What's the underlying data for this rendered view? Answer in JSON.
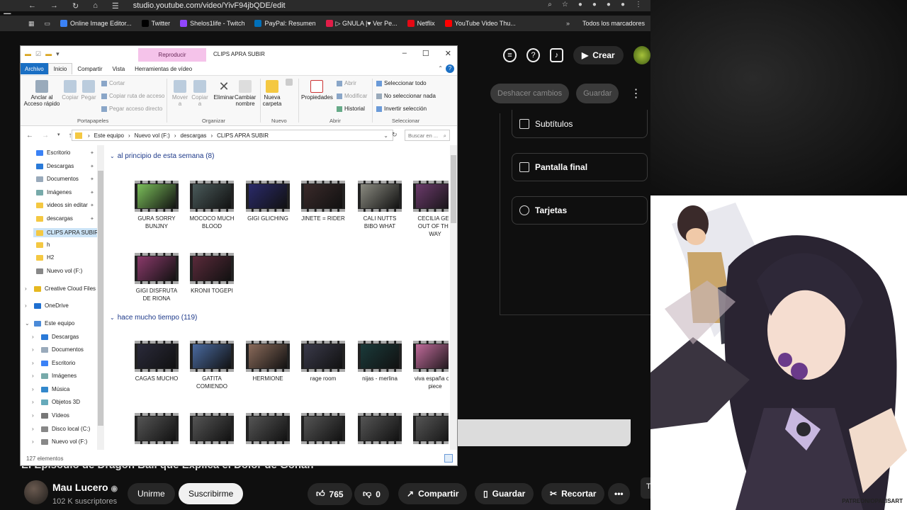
{
  "browser": {
    "url": "studio.youtube.com/video/YivF94jbQDE/edit",
    "bookmarks": [
      {
        "label": "Online Image Editor...",
        "color": "#3b82f6"
      },
      {
        "label": "Twitter",
        "color": "#000000"
      },
      {
        "label": "Shelos1life - Twitch",
        "color": "#9146ff"
      },
      {
        "label": "PayPal: Resumen",
        "color": "#0070ba"
      },
      {
        "label": "▷ GNULA |♥ Ver Pe...",
        "color": "#e11d48"
      },
      {
        "label": "Netflix",
        "color": "#e50914"
      },
      {
        "label": "YouTube Video Thu...",
        "color": "#ff0000"
      }
    ],
    "all_bookmarks": "Todos los marcadores"
  },
  "studio": {
    "create_label": "Crear",
    "discard_label": "Deshacer cambios",
    "save_label": "Guardar",
    "cards": [
      {
        "label": "Subtítulos"
      },
      {
        "label": "Pantalla final"
      },
      {
        "label": "Tarjetas"
      }
    ]
  },
  "youtube": {
    "video_title": "El Episodio de Dragon Ball que Explica el Dolor de Gohan",
    "channel_name": "Mau Lucero",
    "subscribers": "102 K suscriptores",
    "join_label": "Unirme",
    "subscribe_label": "Suscribirme",
    "likes": "765",
    "dislikes": "0",
    "share_label": "Compartir",
    "save_label": "Guardar",
    "clip_label": "Recortar",
    "partial_label": "T"
  },
  "explorer": {
    "context_tab": "Reproducir",
    "window_title": "CLIPS APRA SUBIR",
    "menus": [
      "Archivo",
      "Inicio",
      "Compartir",
      "Vista",
      "Herramientas de vídeo"
    ],
    "ribbon": {
      "pin_label": "Anclar al Acceso rápido",
      "copy_label": "Copiar",
      "paste_label": "Pegar",
      "cut_label": "Cortar",
      "copy_path_label": "Copiar ruta de acceso",
      "paste_shortcut_label": "Pegar acceso directo",
      "clipboard_group": "Portapapeles",
      "move_label": "Mover a",
      "copyto_label": "Copiar a",
      "delete_label": "Eliminar",
      "rename_label": "Cambiar nombre",
      "organize_group": "Organizar",
      "newfolder_label": "Nueva carpeta",
      "new_group": "Nuevo",
      "properties_label": "Propiedades",
      "open_label": "Abrir",
      "modify_label": "Modificar",
      "history_label": "Historial",
      "open_group": "Abrir",
      "select_all": "Seleccionar todo",
      "select_none": "No seleccionar nada",
      "invert_selection": "Invertir selección",
      "select_group": "Seleccionar"
    },
    "breadcrumb": [
      "Este equipo",
      "Nuevo vol (F:)",
      "descargas",
      "CLIPS APRA SUBIR"
    ],
    "search_placeholder": "Buscar en ...",
    "nav_items": [
      "Escritorio",
      "Descargas",
      "Documentos",
      "Imágenes",
      "videos sin editar",
      "descargas",
      "CLIPS APRA SUBIR",
      "h",
      "H2",
      "Nuevo vol (F:)",
      "Creative Cloud Files",
      "OneDrive",
      "Este equipo",
      "Descargas",
      "Documentos",
      "Escritorio",
      "Imágenes",
      "Música",
      "Objetos 3D",
      "Vídeos",
      "Disco local (C:)",
      "Nuevo vol (F:)"
    ],
    "section1": "al principio de esta semana (8)",
    "section2": "hace mucho tiempo (119)",
    "files1": [
      {
        "name": "GURA SORRY BUNJNY",
        "color": "#7bbf5a"
      },
      {
        "name": "MOCOCO MUCH BLOOD",
        "color": "#4a5a5a"
      },
      {
        "name": "GIGI GLICHING",
        "color": "#2a2a6a"
      },
      {
        "name": "JINETE = RIDER",
        "color": "#3a2a2a"
      },
      {
        "name": "CALI NUTTS BIBO WHAT",
        "color": "#8a8a80"
      },
      {
        "name": "CECILIA GET OUT OF THE WAY",
        "color": "#6a3a6a"
      },
      {
        "name": "GIGI DISFRUTA DE RIONA",
        "color": "#8a3a6a"
      },
      {
        "name": "KRONII TOGEPI",
        "color": "#5a2a3a"
      }
    ],
    "files2": [
      {
        "name": "CAGAS MUCHO",
        "color": "#2a2a3a"
      },
      {
        "name": "GATITA COMIENDO",
        "color": "#4a6aa0"
      },
      {
        "name": "HERMIONE",
        "color": "#8a6a5a"
      },
      {
        "name": "rage room",
        "color": "#3a3a4a"
      },
      {
        "name": "nijas - merlina",
        "color": "#1a3a3a"
      },
      {
        "name": "viva españa one piece",
        "color": "#c06a9a"
      }
    ],
    "status": "127 elementos"
  },
  "art": {
    "caption": "PATREON/OPALISART"
  }
}
